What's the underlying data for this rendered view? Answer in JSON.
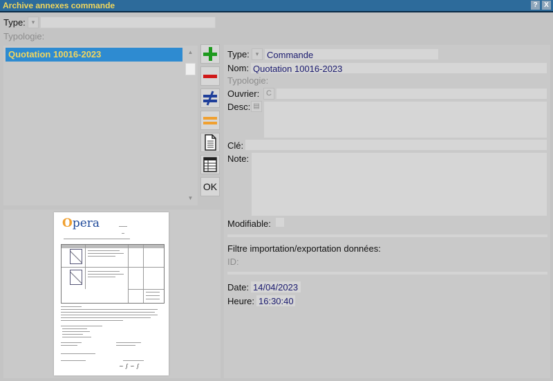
{
  "window": {
    "title": "Archive annexes commande",
    "help_label": "?",
    "close_label": "X"
  },
  "filter": {
    "type_label": "Type:",
    "typologie_label": "Typologie:"
  },
  "list": {
    "items": [
      {
        "label": "Quotation 10016-2023",
        "selected": true
      }
    ]
  },
  "toolbar": {
    "ok_label": "OK"
  },
  "preview": {
    "logo_text": "pera"
  },
  "details": {
    "type_label": "Type:",
    "type_value": "Commande",
    "nom_label": "Nom:",
    "nom_value": "Quotation 10016-2023",
    "typologie_label": "Typologie:",
    "ouvrier_label": "Ouvrier:",
    "ouvrier_btn": "C",
    "desc_label": "Desc:",
    "cle_label": "Clé:",
    "note_label": "Note:",
    "modifiable_label": "Modifiable:",
    "filtre_title": "Filtre importation/exportation données:",
    "id_label": "ID:",
    "date_label": "Date:",
    "date_value": "14/04/2023",
    "heure_label": "Heure:",
    "heure_value": "16:30:40"
  },
  "colors": {
    "titlebar": "#2d6b9b",
    "title_text": "#f2d75c",
    "selection": "#2e8bd1",
    "add": "#1e9a1e",
    "remove": "#d01818",
    "diff": "#1f3f9a",
    "equal": "#f0a030"
  }
}
